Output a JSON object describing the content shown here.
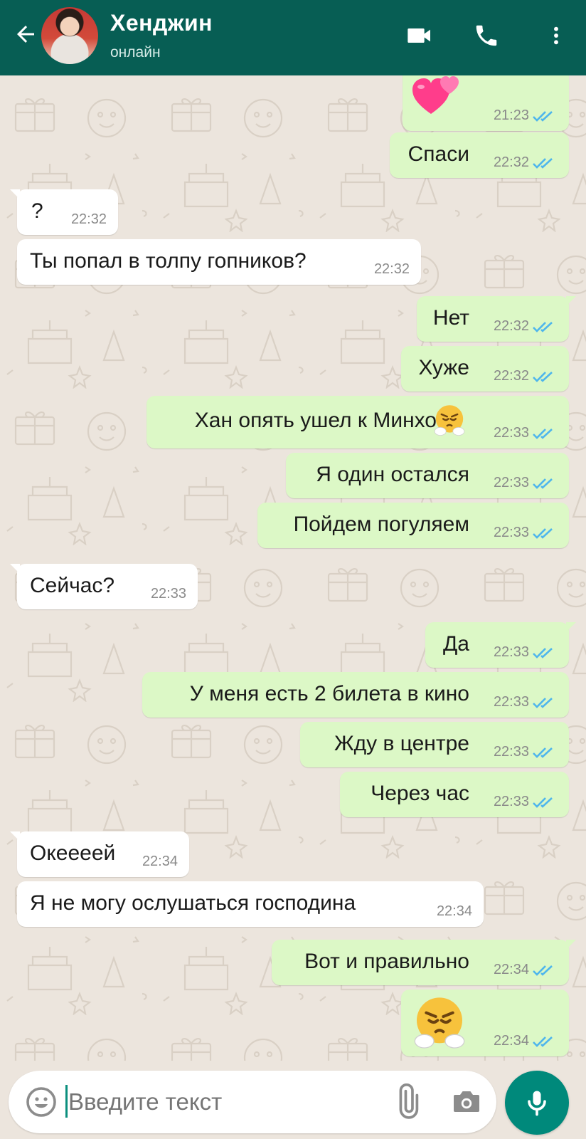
{
  "header": {
    "contact_name": "Хенджин",
    "status": "онлайн",
    "bg_color": "#075e54",
    "icons": [
      "arrow-left-icon",
      "video-call-icon",
      "phone-icon",
      "more-vert-icon"
    ]
  },
  "messages": [
    {
      "dir": "out",
      "kind": "emoji",
      "emoji": "two-hearts-emoji",
      "time": "21:23",
      "status": "read"
    },
    {
      "dir": "out",
      "text": "Спаси",
      "time": "22:32",
      "status": "read"
    },
    {
      "dir": "in",
      "text": "?",
      "time": "22:32"
    },
    {
      "dir": "in",
      "text": "Ты попал в толпу гопников?",
      "time": "22:32"
    },
    {
      "dir": "out",
      "text": "Нет",
      "time": "22:32",
      "status": "read"
    },
    {
      "dir": "out",
      "text": "Хуже",
      "time": "22:32",
      "status": "read"
    },
    {
      "dir": "out",
      "text": "Хан опять ушел к Минхо",
      "emoji": "steam-from-nose-emoji",
      "time": "22:33",
      "status": "read"
    },
    {
      "dir": "out",
      "text": "Я один остался",
      "time": "22:33",
      "status": "read"
    },
    {
      "dir": "out",
      "text": "Пойдем погуляем",
      "time": "22:33",
      "status": "read"
    },
    {
      "dir": "in",
      "text": "Сейчас?",
      "time": "22:33"
    },
    {
      "dir": "out",
      "text": "Да",
      "time": "22:33",
      "status": "read"
    },
    {
      "dir": "out",
      "text": "У меня есть 2 билета в кино",
      "time": "22:33",
      "status": "read"
    },
    {
      "dir": "out",
      "text": "Жду в центре",
      "time": "22:33",
      "status": "read"
    },
    {
      "dir": "out",
      "text": "Через час",
      "time": "22:33",
      "status": "read"
    },
    {
      "dir": "in",
      "text": "Океееей",
      "time": "22:34"
    },
    {
      "dir": "in",
      "text": "Я не могу ослушаться господина",
      "time": "22:34"
    },
    {
      "dir": "out",
      "text": "Вот и правильно",
      "time": "22:34",
      "status": "read"
    },
    {
      "dir": "out",
      "kind": "emoji",
      "emoji": "steam-from-nose-emoji",
      "time": "22:34",
      "status": "read"
    }
  ],
  "composer": {
    "placeholder": "Введите текст",
    "icons": [
      "smiley-icon",
      "paperclip-icon",
      "camera-icon",
      "mic-icon"
    ]
  },
  "colors": {
    "outgoing_bubble": "#dcf8c6",
    "incoming_bubble": "#ffffff",
    "read_ticks": "#4fb6ec",
    "chat_bg": "#ece5dd",
    "mic_button": "#00897b"
  }
}
